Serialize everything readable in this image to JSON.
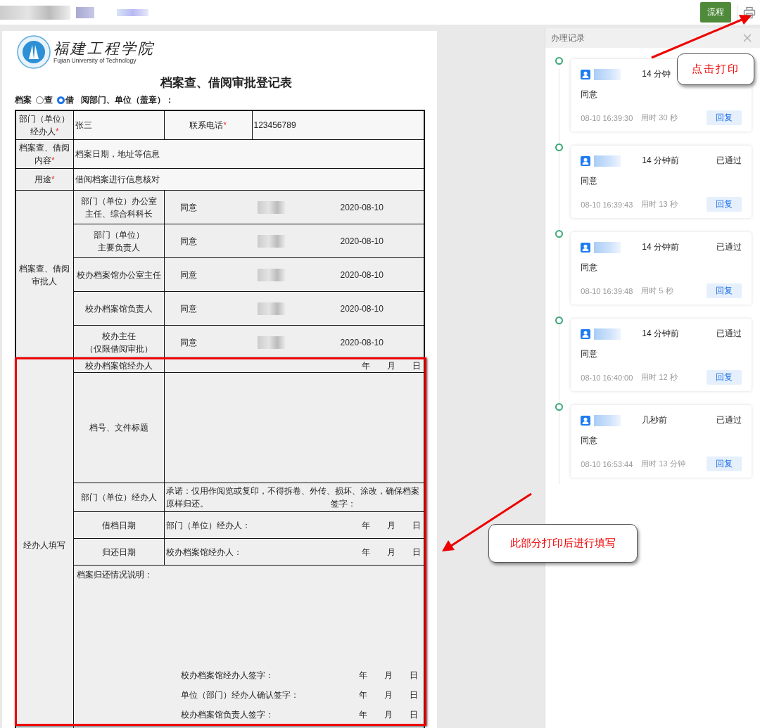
{
  "toolbar": {
    "flow_button": "流程"
  },
  "form": {
    "logo": {
      "name_cn": "福建工程学院",
      "name_en": "Fujian University of Technology"
    },
    "title": "档案查、借阅审批登记表",
    "purpose": {
      "label": "档案",
      "options": [
        {
          "label": "查",
          "selected": false
        },
        {
          "label": "借",
          "selected": true
        }
      ],
      "suffix": "阅部门、单位（盖章）："
    },
    "applicant": {
      "label": "部门（单位）经办人",
      "required_mark": "*",
      "value": "张三",
      "phone_label": "联系电话",
      "phone_required_mark": "*",
      "phone": "123456789"
    },
    "fields": [
      {
        "label": "档案查、借阅内容",
        "required_mark": "*",
        "value": "档案日期，地址等信息"
      },
      {
        "label": "用途",
        "required_mark": "*",
        "value": "借阅档案进行信息核对"
      }
    ],
    "approvals_label": "档案查、借阅审批人",
    "approvals": [
      {
        "role": [
          "部门（单位）办公室",
          "主任、综合科科长"
        ],
        "opinion": "同意",
        "date": "2020-08-10"
      },
      {
        "role": [
          "部门（单位）",
          "主要负责人"
        ],
        "opinion": "同意",
        "date": "2020-08-10"
      },
      {
        "role": [
          "校办档案馆办公室主任"
        ],
        "opinion": "同意",
        "date": "2020-08-10"
      },
      {
        "role": [
          "校办档案馆负责人"
        ],
        "opinion": "同意",
        "date": "2020-08-10"
      },
      {
        "role": [
          "校办主任",
          "（仅限借阅审批）"
        ],
        "opinion": "同意",
        "date": "2020-08-10"
      }
    ],
    "handler_label": "经办人填写",
    "handler_rows": [
      {
        "kind": "date",
        "label": "校办档案馆经办人",
        "ymd": [
          "年",
          "月",
          "日"
        ]
      },
      {
        "kind": "blank",
        "label": "档号、文件标题"
      },
      {
        "kind": "pledge",
        "label": "部门（单位）经办人",
        "text": "承诺：仅用作阅览或复印，不得拆卷、外传、损坏、涂改，确保档案原样归还。",
        "sign": "签字："
      },
      {
        "kind": "signed_date",
        "label": "借档日期",
        "text": "部门（单位）经办人：",
        "ymd": [
          "年",
          "月",
          "日"
        ]
      },
      {
        "kind": "signed_date",
        "label": "归还日期",
        "text": "校办档案馆经办人：",
        "ymd": [
          "年",
          "月",
          "日"
        ]
      }
    ],
    "return_note": {
      "label": "档案归还情况说明：",
      "signatures": [
        {
          "text": "校办档案馆经办人签字：",
          "ymd": [
            "年",
            "月",
            "日"
          ]
        },
        {
          "text": "单位（部门）经办人确认签字：",
          "ymd": [
            "年",
            "月",
            "日"
          ]
        },
        {
          "text": "校办档案馆负责人签字：",
          "ymd": [
            "年",
            "月",
            "日"
          ]
        }
      ]
    }
  },
  "records_panel": {
    "title": "办理记录",
    "records": [
      {
        "time_ago": "14 分钟",
        "comment": "同意",
        "timestamp": "08-10 16:39:30",
        "duration": "用时 30 秒",
        "reply": "回复"
      },
      {
        "time_ago": "14 分钟前",
        "status": "已通过",
        "comment": "同意",
        "timestamp": "08-10 16:39:43",
        "duration": "用时 13 秒",
        "reply": "回复"
      },
      {
        "time_ago": "14 分钟前",
        "status": "已通过",
        "comment": "同意",
        "timestamp": "08-10 16:39:48",
        "duration": "用时 5 秒",
        "reply": "回复"
      },
      {
        "time_ago": "14 分钟前",
        "status": "已通过",
        "comment": "同意",
        "timestamp": "08-10 16:40:00",
        "duration": "用时 12 秒",
        "reply": "回复"
      },
      {
        "time_ago": "几秒前",
        "status": "已通过",
        "comment": "同意",
        "timestamp": "08-10 16:53:44",
        "duration": "用时 13 分钟",
        "reply": "回复"
      }
    ]
  },
  "annotations": [
    {
      "kind": "print",
      "text": "点击打印"
    },
    {
      "kind": "fill",
      "text": "此部分打印后进行填写"
    }
  ]
}
